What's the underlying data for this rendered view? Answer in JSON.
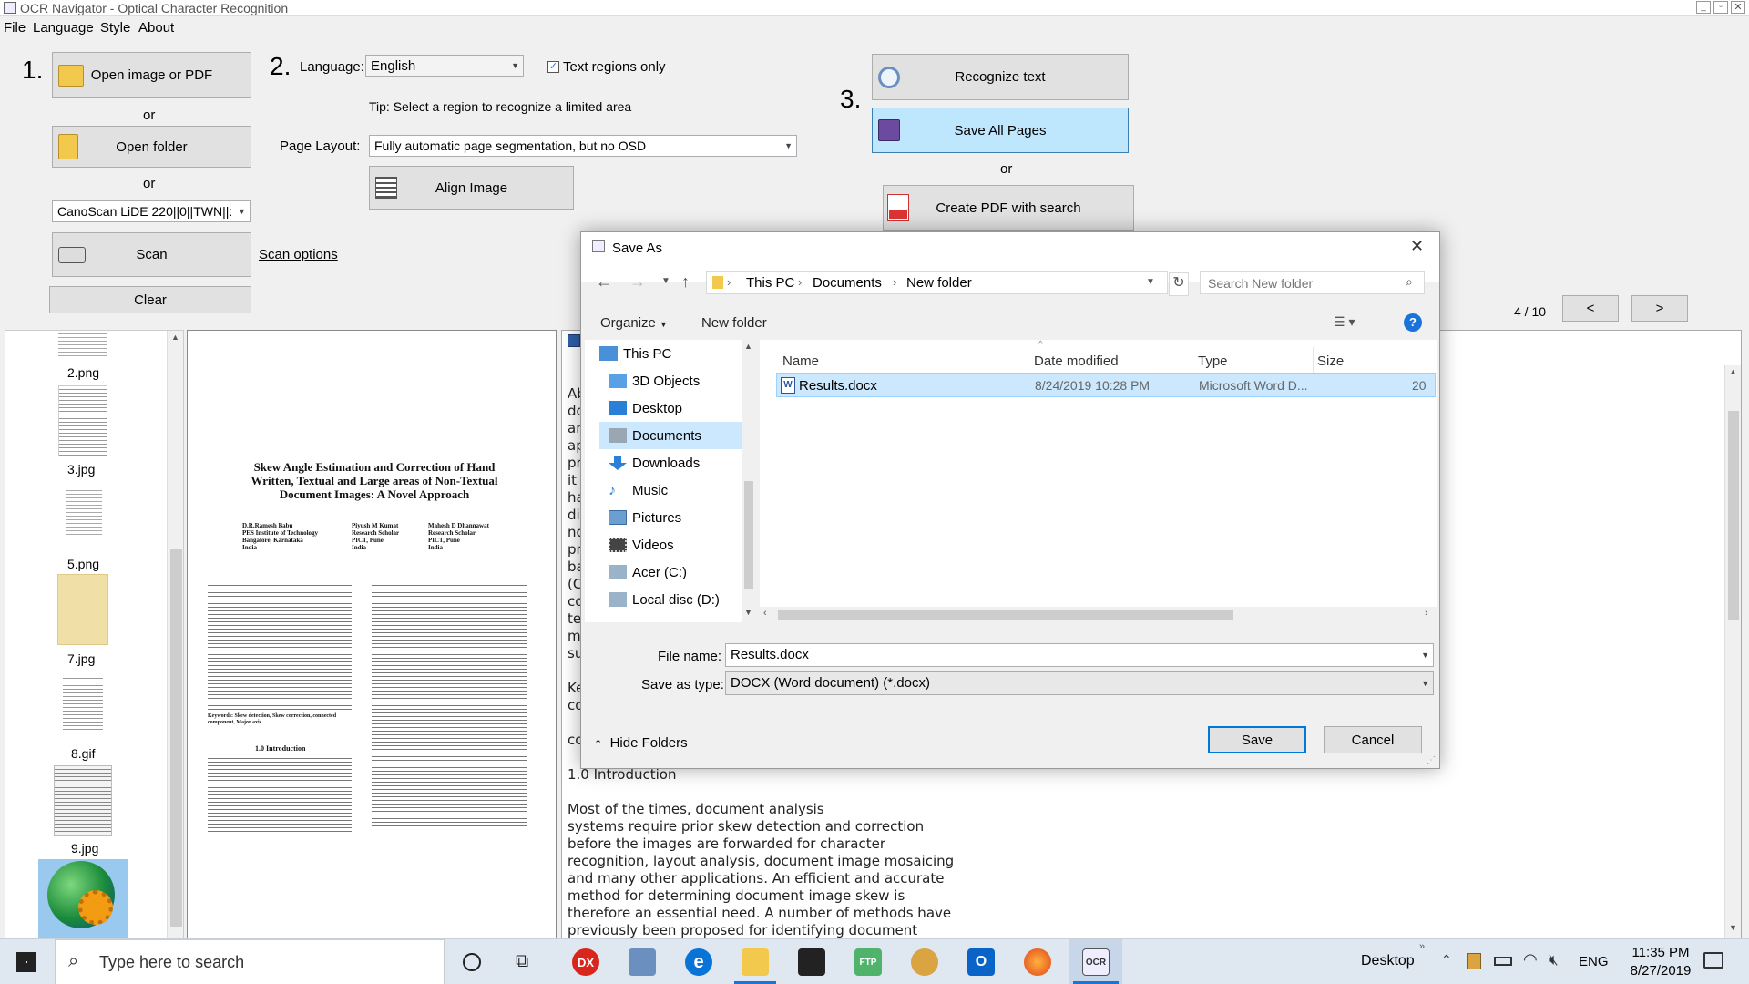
{
  "window": {
    "title": "OCR Navigator - Optical Character Recognition"
  },
  "menu": [
    "File",
    "Language",
    "Style",
    "About"
  ],
  "steps": {
    "one": "1.",
    "two": "2.",
    "three": "3."
  },
  "left": {
    "open_image_label": "Open image or PDF",
    "or1": "or",
    "open_folder_label": "Open folder",
    "or2": "or",
    "scanner_value": "CanoScan LiDE 220||0||TWN||:",
    "scan_label": "Scan",
    "scan_options": "Scan options",
    "clear_label": "Clear"
  },
  "middle": {
    "language_label": "Language:",
    "language_value": "English",
    "text_regions_label": "Text regions only",
    "text_regions_checked": true,
    "tip": "Tip: Select a region to recognize a limited area",
    "page_layout_label": "Page Layout:",
    "page_layout_value": "Fully automatic page segmentation, but no OSD",
    "align_label": "Align Image"
  },
  "right": {
    "recognize_label": "Recognize text",
    "save_all_label": "Save All Pages",
    "or": "or",
    "create_pdf_label": "Create PDF with search",
    "page_counter": "4 / 10",
    "prev_label": "<",
    "next_label": ">"
  },
  "thumbnails": [
    "2.png",
    "3.jpg",
    "5.png",
    "7.jpg",
    "8.gif",
    "9.jpg"
  ],
  "document": {
    "title_lines": [
      "Skew Angle Estimation and Correction of Hand",
      "Written, Textual and Large areas of Non-Textual",
      "Document Images: A Novel Approach"
    ],
    "authors": [
      {
        "name": "D.R.Ramesh Babu",
        "lines": [
          "PES Institute of Technology",
          "Bangalore, Karnataka",
          "India"
        ]
      },
      {
        "name": "Piyush M Kumat",
        "lines": [
          "Research Scholar",
          "PICT, Pune",
          "India"
        ]
      },
      {
        "name": "Mahesh D Dhannawat",
        "lines": [
          "Research Scholar",
          "PICT, Pune",
          "India"
        ]
      }
    ],
    "keywords": "Keywords: Skew detection, Skew correction, connected component, Major axis",
    "intro_heading": "1.0 Introduction"
  },
  "text_output": {
    "fragments": [
      "Ab",
      "do",
      "an",
      "ap",
      "pr",
      "it i",
      "ha",
      "dir",
      "no",
      "pr",
      "ba",
      "(C",
      "co",
      "te",
      "m",
      "su",
      "Ke",
      "co",
      "co"
    ],
    "heading": "1.0 Introduction",
    "lines": [
      "Most of the times, document analysis",
      "systems require prior skew detection and correction",
      "before the images are forwarded for character",
      "recognition, layout analysis, document image mosaicing",
      "and many other applications. An efficient and accurate",
      "method for determining document image skew is",
      "therefore an essential need. A number of methods have",
      "previously been proposed for identifying document"
    ]
  },
  "dialog": {
    "title": "Save As",
    "breadcrumb": [
      "This PC",
      "Documents",
      "New folder"
    ],
    "search_placeholder": "Search New folder",
    "organize_label": "Organize",
    "new_folder_label": "New folder",
    "help_label": "?",
    "tree": [
      "This PC",
      "3D Objects",
      "Desktop",
      "Documents",
      "Downloads",
      "Music",
      "Pictures",
      "Videos",
      "Acer (C:)",
      "Local disc (D:)"
    ],
    "tree_selected": "Documents",
    "columns": [
      "Name",
      "Date modified",
      "Type",
      "Size"
    ],
    "files": [
      {
        "name": "Results.docx",
        "date": "8/24/2019 10:28 PM",
        "type": "Microsoft Word D...",
        "size": "20"
      }
    ],
    "file_name_label": "File name:",
    "file_name_value": "Results.docx",
    "save_type_label": "Save as type:",
    "save_type_value": "DOCX (Word document) (*.docx)",
    "hide_folders_label": "Hide Folders",
    "save_label": "Save",
    "cancel_label": "Cancel"
  },
  "taskbar": {
    "search_placeholder": "Type here to search",
    "desktop_label": "Desktop",
    "lang": "ENG",
    "time": "11:35 PM",
    "date": "8/27/2019"
  }
}
